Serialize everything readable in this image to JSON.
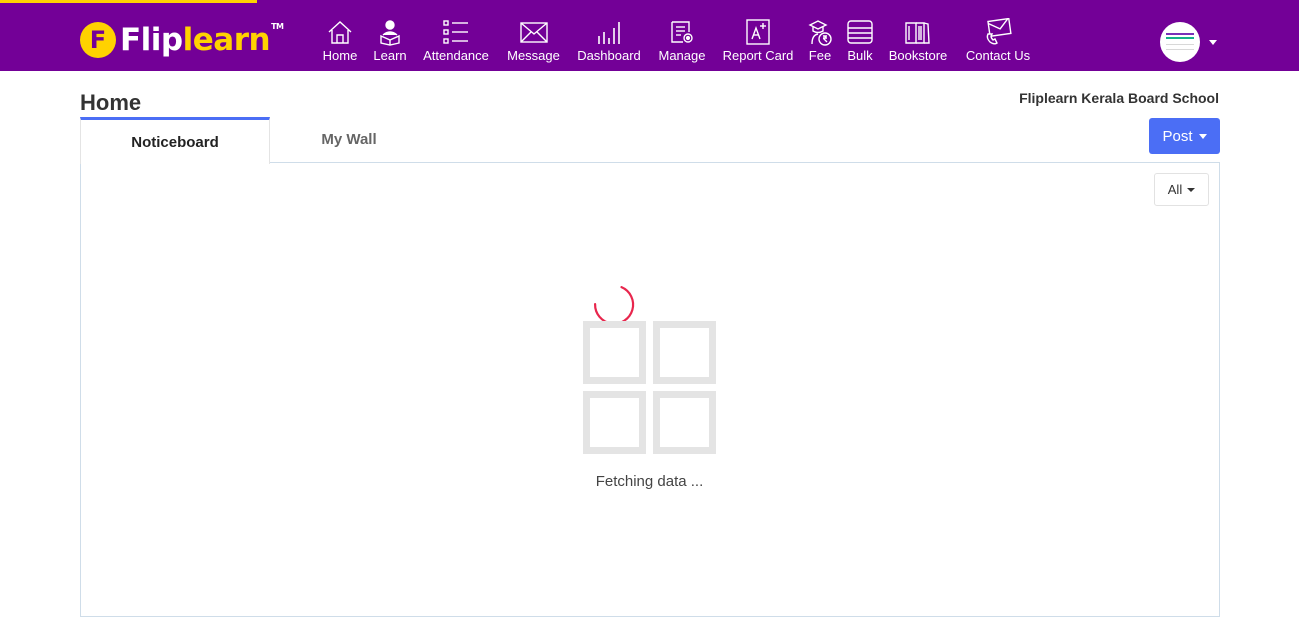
{
  "brand": {
    "name_part1": "Flip",
    "name_part2": "learn",
    "trademark": "TM",
    "badge_letter": "F"
  },
  "colors": {
    "header_bg": "#730097",
    "accent_yellow": "#ffd200",
    "primary_blue": "#4b6ef5",
    "spinner": "#e8264d"
  },
  "nav": {
    "items": [
      {
        "label": "Home",
        "icon": "home-icon"
      },
      {
        "label": "Learn",
        "icon": "learn-icon"
      },
      {
        "label": "Attendance",
        "icon": "attendance-icon"
      },
      {
        "label": "Message",
        "icon": "message-icon"
      },
      {
        "label": "Dashboard",
        "icon": "dashboard-icon"
      },
      {
        "label": "Manage",
        "icon": "manage-icon"
      },
      {
        "label": "Report Card",
        "icon": "report-card-icon"
      },
      {
        "label": "Fee",
        "icon": "fee-icon"
      },
      {
        "label": "Bulk",
        "icon": "bulk-icon"
      },
      {
        "label": "Bookstore",
        "icon": "bookstore-icon"
      },
      {
        "label": "Contact Us",
        "icon": "contact-icon"
      }
    ]
  },
  "page": {
    "title": "Home",
    "school_name": "Fliplearn Kerala Board School"
  },
  "tabs": [
    {
      "label": "Noticeboard",
      "active": true
    },
    {
      "label": "My Wall",
      "active": false
    }
  ],
  "post_button": {
    "label": "Post"
  },
  "filter": {
    "selected": "All"
  },
  "loading": {
    "text": "Fetching data ..."
  }
}
